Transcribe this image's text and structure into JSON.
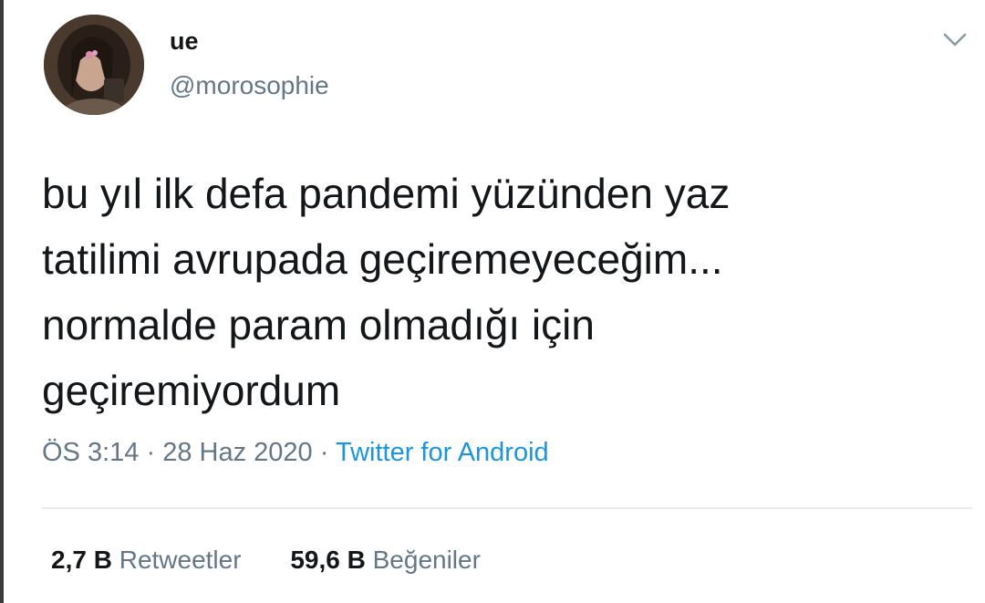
{
  "user": {
    "display_name": "ue",
    "handle": "@morosophie"
  },
  "tweet": {
    "text": "bu yıl ilk defa pandemi yüzünden yaz\ntatilimi avrupada geçiremeyeceğim...\nnormalde param olmadığı için\ngeçiremiyordum",
    "time": "ÖS 3:14",
    "date": "28 Haz 2020",
    "source": "Twitter for Android",
    "separator": "·"
  },
  "stats": {
    "retweets_count": "2,7 B",
    "retweets_label": "Retweetler",
    "likes_count": "59,6 B",
    "likes_label": "Beğeniler"
  },
  "icons": {
    "caret": "chevron-down-icon",
    "avatar": "avatar"
  },
  "colors": {
    "text": "#14171a",
    "secondary": "#657786",
    "link": "#1b95e0",
    "divider": "#e6ecf0"
  }
}
